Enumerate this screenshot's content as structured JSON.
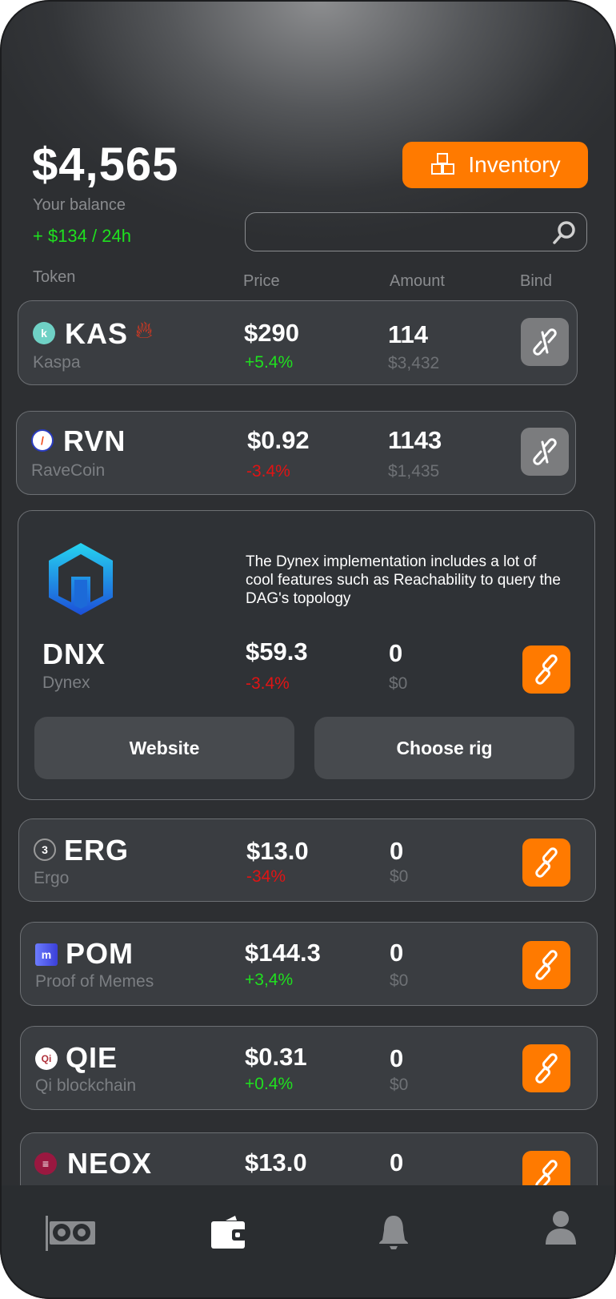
{
  "header": {
    "balance": "$4,565",
    "balance_label": "Your balance",
    "change": "+ $134 / 24h",
    "inventory_label": "Inventory",
    "search_placeholder": ""
  },
  "columns": {
    "token": "Token",
    "price": "Price",
    "amount": "Amount",
    "bind": "Bind"
  },
  "tokens": [
    {
      "symbol": "KAS",
      "name": "Kaspa",
      "price": "$290",
      "change": "+5.4%",
      "trend": "up",
      "amount": "114",
      "usd": "$3,432",
      "bound": false,
      "hot": true
    },
    {
      "symbol": "RVN",
      "name": "RaveCoin",
      "price": "$0.92",
      "change": "-3.4%",
      "trend": "down",
      "amount": "1143",
      "usd": "$1,435",
      "bound": false
    },
    {
      "symbol": "DNX",
      "name": "Dynex",
      "price": "$59.3",
      "change": "-3.4%",
      "trend": "down",
      "amount": "0",
      "usd": "$0",
      "bound": true,
      "expanded": true,
      "description": "The Dynex  implementation includes a lot of cool features such as Reachability to query the DAG's topology",
      "website_label": "Website",
      "choose_rig_label": "Choose rig"
    },
    {
      "symbol": "ERG",
      "name": "Ergo",
      "price": "$13.0",
      "change": "-34%",
      "trend": "down",
      "amount": "0",
      "usd": "$0",
      "bound": true
    },
    {
      "symbol": "POM",
      "name": "Proof of Memes",
      "price": "$144.3",
      "change": "+3,4%",
      "trend": "up",
      "amount": "0",
      "usd": "$0",
      "bound": true
    },
    {
      "symbol": "QIE",
      "name": "Qi blockchain",
      "price": "$0.31",
      "change": "+0.4%",
      "trend": "up",
      "amount": "0",
      "usd": "$0",
      "bound": true
    },
    {
      "symbol": "NEOX",
      "name": "",
      "price": "$13.0",
      "change": "",
      "trend": "",
      "amount": "0",
      "usd": "",
      "bound": true
    }
  ],
  "colors": {
    "accent": "#ff7a00",
    "up": "#1fe01f",
    "down": "#e01414",
    "background": "#2d2f32"
  },
  "nav": [
    {
      "icon": "gpu-icon"
    },
    {
      "icon": "wallet-icon",
      "active": true
    },
    {
      "icon": "bell-icon"
    },
    {
      "icon": "profile-icon"
    }
  ]
}
